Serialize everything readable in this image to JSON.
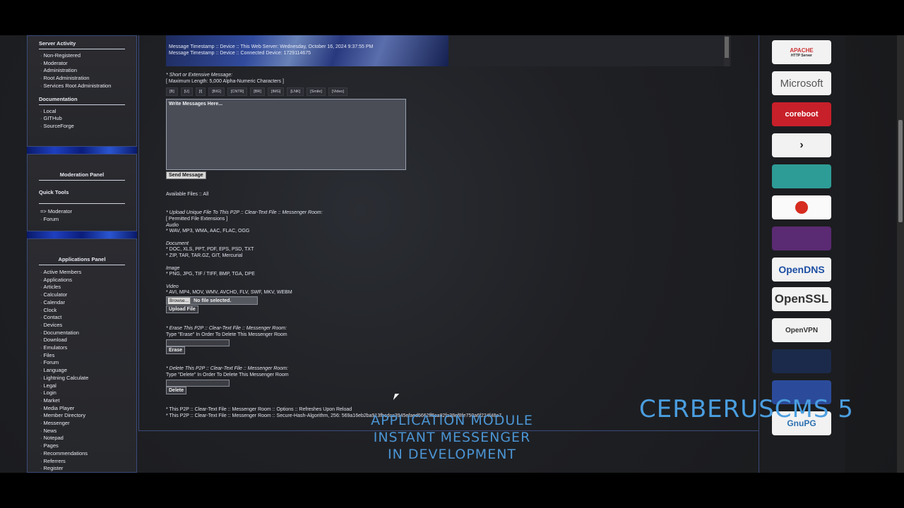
{
  "sidebar": {
    "server_activity": {
      "title": "Server Activity",
      "items": [
        "Non-Registered",
        "Moderator",
        "Administration",
        "Root Administration",
        "Services Root Administration"
      ]
    },
    "documentation": {
      "title": "Documentation",
      "items": [
        "Local",
        "GITHub",
        "SourceForge"
      ]
    },
    "moderation": {
      "title": "Moderation Panel",
      "quick_tools_title": "Quick Tools",
      "items": [
        "=> Moderator",
        "Forum"
      ]
    },
    "applications": {
      "title": "Applications Panel",
      "items": [
        "Active Members",
        "Applications",
        "Articles",
        "Calculator",
        "Calendar",
        "Clock",
        "Contact",
        "Devices",
        "Documentation",
        "Download",
        "Emulators",
        "Files",
        "Forum",
        "Language",
        "Lightning Calculate",
        "Legal",
        "Login",
        "Market",
        "Media Player",
        "Member Directory",
        "Messenger",
        "News",
        "Notepad",
        "Pages",
        "Recommendations",
        "Referrers",
        "Register"
      ]
    }
  },
  "messages": {
    "line1": "Message Timestamp :: Device :: This Web Server: Wednesday, October 16, 2024 9:37:55 PM",
    "line2": "Message Timestamp :: Device :: Connected Device: 1729114675"
  },
  "compose": {
    "label": "* Short or Extensive Message:",
    "max_length": "[ Maximum Length: 5,000 Alpha-Numeric Characters ]",
    "bbcodes": [
      "[B]",
      "[U]",
      "[I]",
      "[BIG]",
      "[CNTR]",
      "[BR]",
      "[IMG]",
      "[LNK]",
      "[Smile]",
      "[Video]"
    ],
    "placeholder": "Write Messages Here...",
    "send_button": "Send Message"
  },
  "files": {
    "available": "Available Files :: All",
    "upload_label": "* Upload Unique File To This P2P :: Clear-Text File :: Messenger Room:",
    "permitted": "[ Permitted File Extensions ]",
    "audio_title": "Audio",
    "audio": "* WAV, MP3, WMA, AAC, FLAC, OGG",
    "document_title": "Document",
    "document1": "* DOC, XLS, PPT, PDF, EPS, PSD, TXT",
    "document2": "* ZIP, TAR, TAR.GZ, GIT, Mercurial",
    "image_title": "Image",
    "image": "* PNG, JPG, TIF / TIFF, BMP, TGA, DPE",
    "video_title": "Video",
    "video": "* AVI, MP4, MOV, WMV, AVCHD, FLV, SWF, MKV, WEBM",
    "browse_button": "Browse...",
    "no_file": "No file selected.",
    "upload_button": "Upload File"
  },
  "erase": {
    "label": "* Erase This P2P :: Clear-Text File :: Messenger Room:",
    "hint": "Type \"Erase\" In Order To Delete This Messenger Room",
    "button": "Erase"
  },
  "delete": {
    "label": "* Delete This P2P :: Clear-Text File :: Messenger Room:",
    "hint": "Type \"Delete\" In Order To Delete This Messenger Room",
    "button": "Delete"
  },
  "footer": {
    "options": "* This P2P :: Clear-Text File :: Messenger Room :: Options :: Refreshes Upon Reload",
    "hash": "* This P2P :: Clear-Text File :: Messenger Room :: Secure-Hash-Algorithm, 256: 569a16eb2ba913fbcdca3945efaed5662ff6ca82fa38ef8fe750a6f224f48e7"
  },
  "logos": {
    "apache": "APACHE",
    "apache_sub": "HTTP Server",
    "microsoft": "Microsoft",
    "coreboot": "coreboot",
    "opendns": "OpenDNS",
    "openssl": "OpenSSL",
    "openvpn": "OpenVPN",
    "gnupg": "GnuPG"
  },
  "overlay": {
    "line1": "APPLICATION MODULE",
    "line2": "INSTANT MESSENGER",
    "line3": "IN DEVELOPMENT",
    "brand": "CERBERUSCMS 5"
  },
  "colors": {
    "accent_blue": "#4a9ee0",
    "panel_border": "#3b4a7a"
  }
}
